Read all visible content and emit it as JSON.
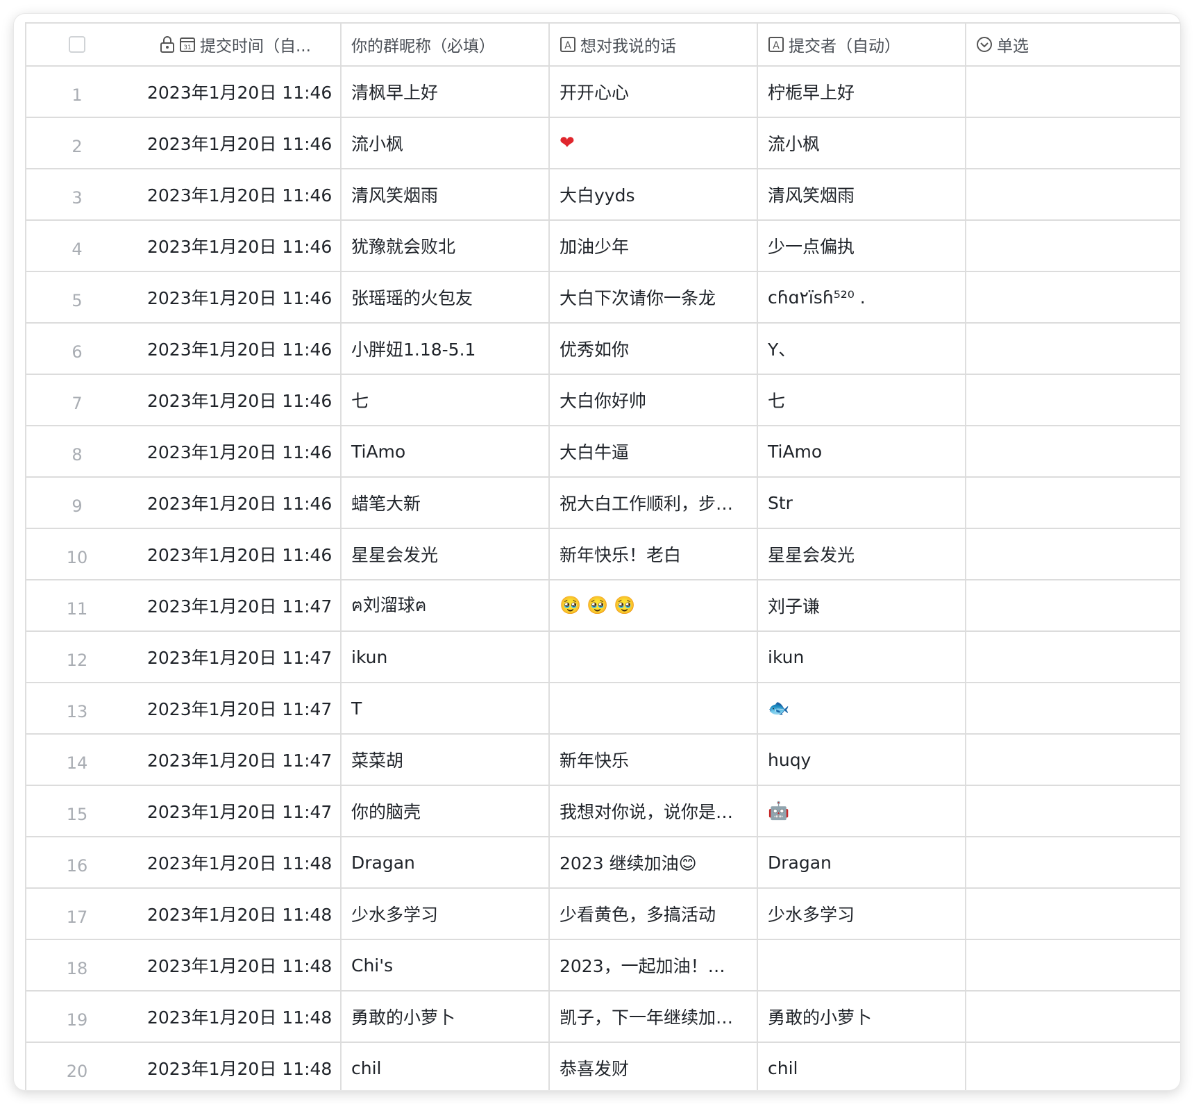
{
  "columns": {
    "submit_time": "提交时间（自...",
    "nickname": "你的群昵称（必填）",
    "message": "想对我说的话",
    "submitter": "提交者（自动）",
    "single_select": "单选"
  },
  "icons": {
    "lock": "lock-icon",
    "calendar": "calendar-icon",
    "text": "text-field-icon",
    "select": "single-select-icon"
  },
  "rows": [
    {
      "index": "1",
      "time": "2023年1月20日 11:46",
      "nickname": "清枫早上好",
      "message": "开开心心",
      "submitter": "柠栀早上好",
      "select": ""
    },
    {
      "index": "2",
      "time": "2023年1月20日 11:46",
      "nickname": "流小枫",
      "message": "❤",
      "submitter": "流小枫",
      "select": ""
    },
    {
      "index": "3",
      "time": "2023年1月20日 11:46",
      "nickname": "清风笑烟雨",
      "message": "大白yyds",
      "submitter": "清风笑烟雨",
      "select": ""
    },
    {
      "index": "4",
      "time": "2023年1月20日 11:46",
      "nickname": "犹豫就会败北",
      "message": "加油少年",
      "submitter": "少一点偏执",
      "select": ""
    },
    {
      "index": "5",
      "time": "2023年1月20日 11:46",
      "nickname": "张瑶瑶的火包友",
      "message": "大白下次请你一条龙",
      "submitter": "cɦɑ٢ïsɦ⁵²⁰ .",
      "select": ""
    },
    {
      "index": "6",
      "time": "2023年1月20日 11:46",
      "nickname": "小胖妞1.18-5.1",
      "message": "优秀如你",
      "submitter": "Y、",
      "select": ""
    },
    {
      "index": "7",
      "time": "2023年1月20日 11:46",
      "nickname": "七",
      "message": "大白你好帅",
      "submitter": "七",
      "select": ""
    },
    {
      "index": "8",
      "time": "2023年1月20日 11:46",
      "nickname": "TiAmo",
      "message": "大白牛逼",
      "submitter": "TiAmo",
      "select": ""
    },
    {
      "index": "9",
      "time": "2023年1月20日 11:46",
      "nickname": "蜡笔大新",
      "message": "祝大白工作顺利，步…",
      "submitter": "Str",
      "select": ""
    },
    {
      "index": "10",
      "time": "2023年1月20日 11:46",
      "nickname": "星星会发光",
      "message": "新年快乐！老白",
      "submitter": "星星会发光",
      "select": ""
    },
    {
      "index": "11",
      "time": "2023年1月20日 11:47",
      "nickname": "ฅ刘溜球ฅ",
      "message": "🥹 🥹 🥹",
      "submitter": "刘子谦",
      "select": ""
    },
    {
      "index": "12",
      "time": "2023年1月20日 11:47",
      "nickname": "ikun",
      "message": "",
      "submitter": "ikun",
      "select": ""
    },
    {
      "index": "13",
      "time": "2023年1月20日 11:47",
      "nickname": "T",
      "message": "",
      "submitter": "🐟",
      "select": ""
    },
    {
      "index": "14",
      "time": "2023年1月20日 11:47",
      "nickname": "菜菜胡",
      "message": "新年快乐",
      "submitter": "huqy",
      "select": ""
    },
    {
      "index": "15",
      "time": "2023年1月20日 11:47",
      "nickname": "你的脑壳",
      "message": "我想对你说，说你是…",
      "submitter": "🤖",
      "select": ""
    },
    {
      "index": "16",
      "time": "2023年1月20日 11:48",
      "nickname": "Dragan",
      "message": "2023 继续加油😊",
      "submitter": "Dragan",
      "select": ""
    },
    {
      "index": "17",
      "time": "2023年1月20日 11:48",
      "nickname": "少水多学习",
      "message": "少看黄色，多搞活动",
      "submitter": "少水多学习",
      "select": ""
    },
    {
      "index": "18",
      "time": "2023年1月20日 11:48",
      "nickname": "Chi's",
      "message": "2023，一起加油！…",
      "submitter": "",
      "select": ""
    },
    {
      "index": "19",
      "time": "2023年1月20日 11:48",
      "nickname": "勇敢的小萝卜",
      "message": "凯子，下一年继续加…",
      "submitter": "勇敢的小萝卜",
      "select": ""
    },
    {
      "index": "20",
      "time": "2023年1月20日 11:48",
      "nickname": "chil",
      "message": "恭喜发财",
      "submitter": "chil",
      "select": ""
    }
  ]
}
